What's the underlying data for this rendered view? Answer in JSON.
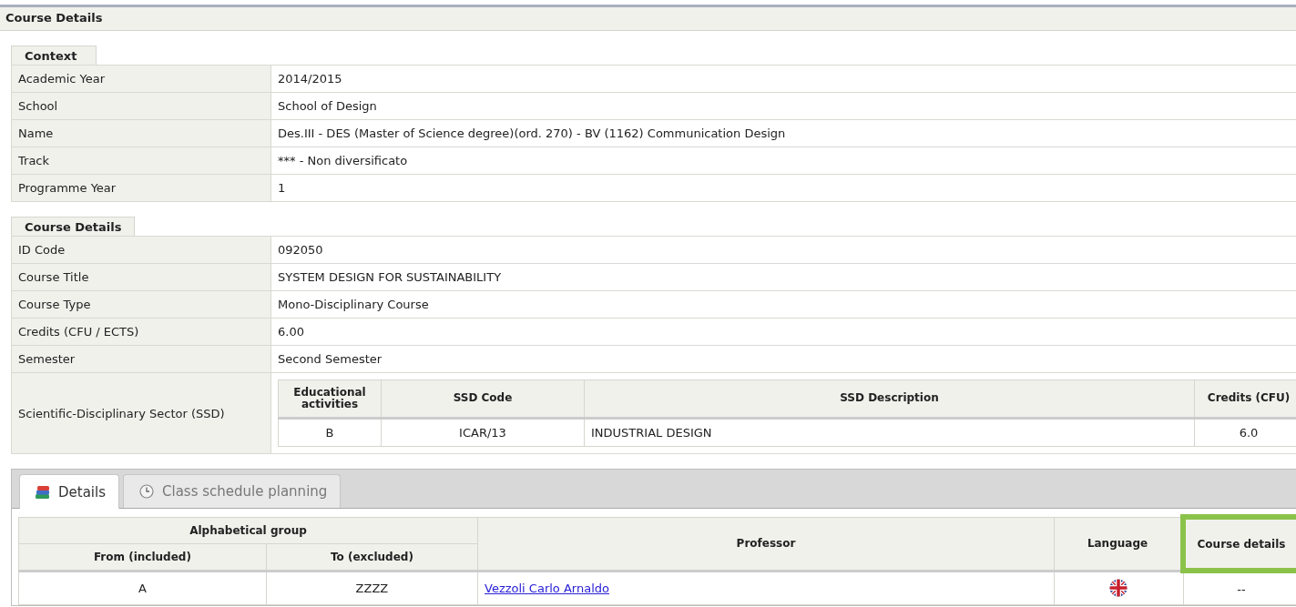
{
  "page_title": "Course Details",
  "context": {
    "title": "Context",
    "rows": [
      {
        "label": "Academic Year",
        "value": "2014/2015"
      },
      {
        "label": "School",
        "value": "School of Design"
      },
      {
        "label": "Name",
        "value": "Des.III - DES (Master of Science degree)(ord. 270) - BV (1162) Communication Design"
      },
      {
        "label": "Track",
        "value": "*** - Non diversificato"
      },
      {
        "label": "Programme Year",
        "value": "1"
      }
    ]
  },
  "course_details": {
    "title": "Course Details",
    "rows": [
      {
        "label": "ID Code",
        "value": "092050"
      },
      {
        "label": "Course Title",
        "value": "SYSTEM DESIGN FOR SUSTAINABILITY"
      },
      {
        "label": "Course Type",
        "value": "Mono-Disciplinary Course"
      },
      {
        "label": "Credits (CFU / ECTS)",
        "value": "6.00"
      },
      {
        "label": "Semester",
        "value": "Second Semester"
      }
    ],
    "ssd": {
      "label": "Scientific-Disciplinary Sector (SSD)",
      "columns": [
        "Educational activities",
        "SSD Code",
        "SSD Description",
        "Credits (CFU)"
      ],
      "rows": [
        [
          "B",
          "ICAR/13",
          "INDUSTRIAL DESIGN",
          "6.0"
        ]
      ]
    }
  },
  "tabs": [
    {
      "label": "Details",
      "selected": true
    },
    {
      "label": "Class schedule planning",
      "selected": false
    }
  ],
  "groups_table": {
    "group_heading": "Alphabetical group",
    "columns": [
      "From (included)",
      "To (excluded)",
      "Professor",
      "Language",
      "Course details"
    ],
    "rows": [
      {
        "from": "A",
        "to": "ZZZZ",
        "professor": "Vezzoli Carlo Arnaldo",
        "course_details": "--"
      }
    ]
  }
}
